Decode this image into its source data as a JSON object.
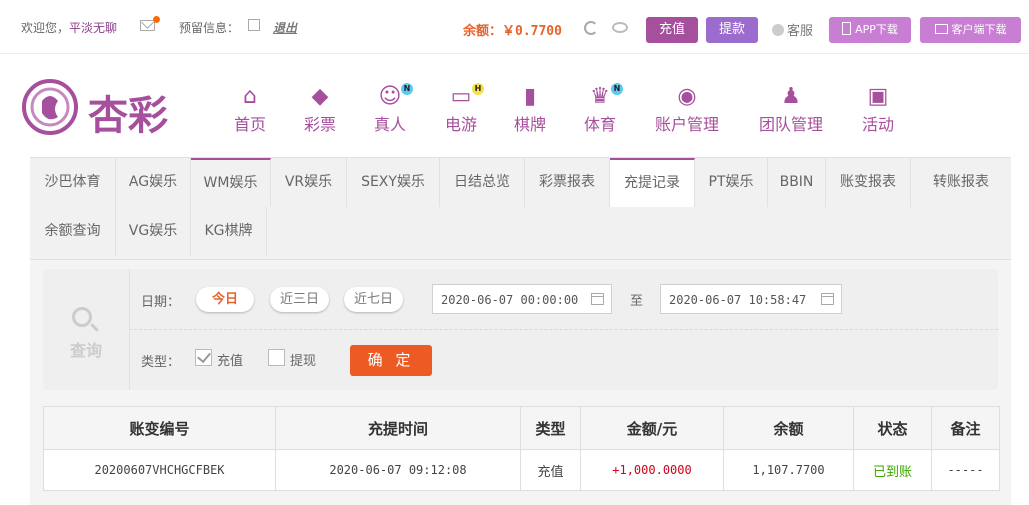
{
  "topbar": {
    "welcome": "欢迎您，",
    "username": "平淡无聊",
    "reserved_info": "预留信息：",
    "logout": "退出",
    "balance": "余额：￥0.7700",
    "recharge": "充值",
    "withdraw": "提款",
    "customer_service": "客服",
    "app_download": "APP下载",
    "client_download": "客户端下载"
  },
  "brand": {
    "logo_text": "杏彩"
  },
  "nav": [
    {
      "label": "首页",
      "icon": "home-icon"
    },
    {
      "label": "彩票",
      "icon": "lottery-icon"
    },
    {
      "label": "真人",
      "icon": "live-dealer-icon",
      "badge": "N"
    },
    {
      "label": "电游",
      "icon": "gamepad-icon",
      "badge": "H"
    },
    {
      "label": "棋牌",
      "icon": "cards-icon"
    },
    {
      "label": "体育",
      "icon": "trophy-icon",
      "badge": "N"
    },
    {
      "label": "账户管理",
      "icon": "account-icon"
    },
    {
      "label": "团队管理",
      "icon": "team-icon"
    },
    {
      "label": "活动",
      "icon": "gift-icon"
    }
  ],
  "tabs": [
    "沙巴体育",
    "AG娱乐",
    "WM娱乐",
    "VR娱乐",
    "SEXY娱乐",
    "日结总览",
    "彩票报表",
    "充提记录",
    "PT娱乐",
    "BBIN",
    "账变报表",
    "转账报表",
    "余额查询",
    "VG娱乐",
    "KG棋牌"
  ],
  "active_tab": "充提记录",
  "filter": {
    "query_label": "查询",
    "date_label": "日期：",
    "presets": [
      "今日",
      "近三日",
      "近七日"
    ],
    "selected_preset": "今日",
    "start_datetime": "2020-06-07 00:00:00",
    "to_label": "至",
    "end_datetime": "2020-06-07 10:58:47",
    "type_label": "类型：",
    "type_options": [
      {
        "label": "充值",
        "checked": true
      },
      {
        "label": "提现",
        "checked": false
      }
    ],
    "confirm": "确 定"
  },
  "table": {
    "columns": [
      "账变编号",
      "充提时间",
      "类型",
      "金额/元",
      "余额",
      "状态",
      "备注"
    ],
    "rows": [
      {
        "id": "20200607VHCHGCFBEK",
        "time": "2020-06-07 09:12:08",
        "type": "充值",
        "amount": "+1,000.0000",
        "balance": "1,107.7700",
        "status": "已到账",
        "note": "-----"
      }
    ]
  },
  "colors": {
    "brand": "#a64f9c",
    "accent": "#ee5a24",
    "success": "#3aa500",
    "amount": "#d0021b"
  }
}
